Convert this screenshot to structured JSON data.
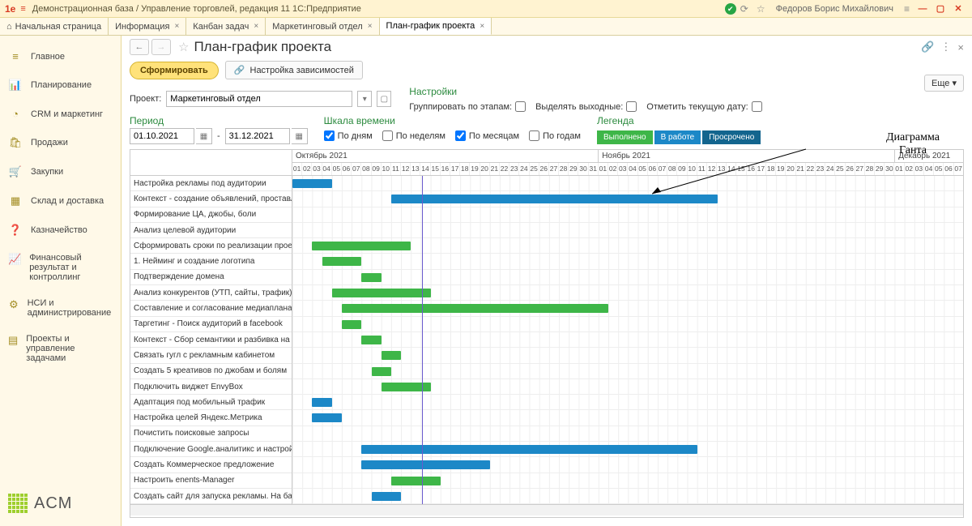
{
  "titlebar": {
    "logo": "1e",
    "title": "Демонстрационная база / Управление торговлей, редакция 11 1С:Предприятие",
    "user": "Федоров Борис Михайлович"
  },
  "tabs": {
    "home": "Начальная страница",
    "items": [
      {
        "label": "Информация"
      },
      {
        "label": "Канбан задач"
      },
      {
        "label": "Маркетинговый отдел"
      },
      {
        "label": "План-график проекта",
        "active": true
      }
    ]
  },
  "sidebar": {
    "items": [
      {
        "icon": "≡",
        "label": "Главное"
      },
      {
        "icon": "📊",
        "label": "Планирование"
      },
      {
        "icon": "◔",
        "label": "CRM и маркетинг"
      },
      {
        "icon": "🛍",
        "label": "Продажи"
      },
      {
        "icon": "🛒",
        "label": "Закупки"
      },
      {
        "icon": "▦",
        "label": "Склад и доставка"
      },
      {
        "icon": "❓",
        "label": "Казначейство"
      },
      {
        "icon": "📈",
        "label": "Финансовый результат и контроллинг"
      },
      {
        "icon": "⚙",
        "label": "НСИ и администрирование"
      },
      {
        "icon": "▤",
        "label": "Проекты и управление задачами"
      }
    ],
    "brand": "ACM"
  },
  "page": {
    "title": "План-график проекта",
    "btn_form": "Сформировать",
    "btn_deps": "Настройка зависимостей",
    "more": "Еще ▾",
    "project_label": "Проект:",
    "project_value": "Маркетинговый отдел",
    "settings_head": "Настройки",
    "group_by_stages": "Группировать по этапам:",
    "highlight_weekends": "Выделять выходные:",
    "mark_today": "Отметить текущую дату:",
    "period_head": "Период",
    "date_from": "01.10.2021",
    "date_to": "31.12.2021",
    "date_sep": "-",
    "timescale_head": "Шкала времени",
    "scale": {
      "days": "По дням",
      "weeks": "По неделям",
      "months": "По месяцам",
      "years": "По годам"
    },
    "legend_head": "Легенда",
    "legend": {
      "done": "Выполнено",
      "work": "В работе",
      "late": "Просрочено"
    },
    "annotation_line1": "Диаграмма",
    "annotation_line2": "Ганта"
  },
  "chart_data": {
    "type": "gantt",
    "months": [
      {
        "name": "Октябрь 2021",
        "days": 31
      },
      {
        "name": "Ноябрь 2021",
        "days": 30
      },
      {
        "name": "Декабрь 2021",
        "days": 9
      }
    ],
    "day_width": 12.2,
    "tasks": [
      {
        "name": "Настройка рекламы под аудитории",
        "bars": [
          {
            "start": 1,
            "end": 4,
            "status": "work"
          }
        ]
      },
      {
        "name": "Контекст - создание объявлений, проставление с...",
        "bars": [
          {
            "start": 11,
            "end": 43,
            "status": "work"
          }
        ]
      },
      {
        "name": "Формирование ЦА, джобы, боли",
        "bars": []
      },
      {
        "name": "Анализ целевой аудитории",
        "bars": []
      },
      {
        "name": "Сформировать сроки по реализации проекта.",
        "bars": [
          {
            "start": 3,
            "end": 12,
            "status": "done"
          }
        ]
      },
      {
        "name": "1. Нейминг и создание логотипа",
        "bars": [
          {
            "start": 4,
            "end": 7,
            "status": "done"
          }
        ]
      },
      {
        "name": "Подтверждение домена",
        "bars": [
          {
            "start": 8,
            "end": 9,
            "status": "done"
          }
        ]
      },
      {
        "name": "Анализ конкурентов (УТП, сайты, трафик)",
        "bars": [
          {
            "start": 5,
            "end": 14,
            "status": "done"
          }
        ]
      },
      {
        "name": "Составление и согласование медиаплана",
        "bars": [
          {
            "start": 6,
            "end": 32,
            "status": "done"
          }
        ]
      },
      {
        "name": "Таргетинг - Поиск аудиторий в facebook",
        "bars": [
          {
            "start": 6,
            "end": 7,
            "status": "done"
          }
        ]
      },
      {
        "name": "Контекст - Сбор семантики и разбивка на кластеры",
        "bars": [
          {
            "start": 8,
            "end": 9,
            "status": "done"
          }
        ]
      },
      {
        "name": "Связать гугл с рекламным кабинетом",
        "bars": [
          {
            "start": 10,
            "end": 11,
            "status": "done"
          }
        ]
      },
      {
        "name": "Создать 5 креативов по джобам и болям",
        "bars": [
          {
            "start": 9,
            "end": 10,
            "status": "done"
          }
        ]
      },
      {
        "name": "Подключить виджет EnvyBox",
        "bars": [
          {
            "start": 10,
            "end": 14,
            "status": "done"
          }
        ]
      },
      {
        "name": "Адаптация под мобильный трафик",
        "bars": [
          {
            "start": 3,
            "end": 4,
            "status": "work"
          }
        ]
      },
      {
        "name": "Настройка целей Яндекс.Метрика",
        "bars": [
          {
            "start": 3,
            "end": 5,
            "status": "work"
          }
        ]
      },
      {
        "name": "Почистить поисковые запросы",
        "bars": []
      },
      {
        "name": "Подключение Google.аналитикс и настройка целей",
        "bars": [
          {
            "start": 8,
            "end": 41,
            "status": "work"
          }
        ]
      },
      {
        "name": "Создать Коммерческое предложение",
        "bars": [
          {
            "start": 8,
            "end": 20,
            "status": "work"
          }
        ]
      },
      {
        "name": "Настроить enents-Manager",
        "bars": [
          {
            "start": 11,
            "end": 15,
            "status": "done"
          }
        ]
      },
      {
        "name": "Создать сайт для запуска рекламы. На базе тильды",
        "bars": [
          {
            "start": 9,
            "end": 11,
            "status": "work"
          }
        ]
      }
    ]
  }
}
